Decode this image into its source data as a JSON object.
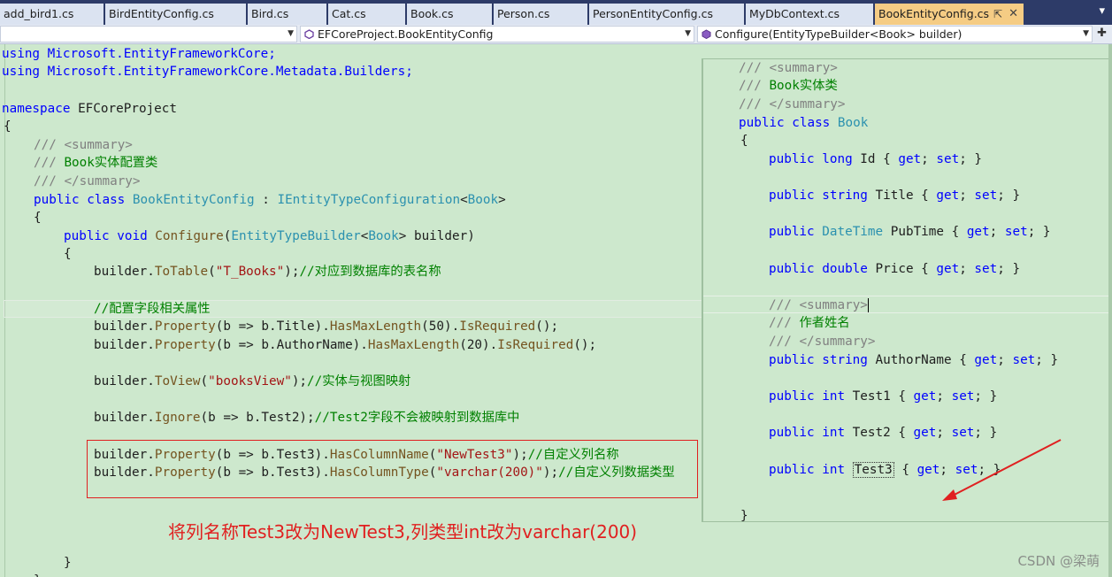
{
  "tabs": [
    {
      "label": "add_bird1.cs",
      "active": false
    },
    {
      "label": "BirdEntityConfig.cs",
      "active": false
    },
    {
      "label": "Bird.cs",
      "active": false
    },
    {
      "label": "Cat.cs",
      "active": false
    },
    {
      "label": "Book.cs",
      "active": false
    },
    {
      "label": "Person.cs",
      "active": false
    },
    {
      "label": "PersonEntityConfig.cs",
      "active": false
    },
    {
      "label": "MyDbContext.cs",
      "active": false
    },
    {
      "label": "BookEntityConfig.cs",
      "active": true
    }
  ],
  "tab_pin_icon": "pin-icon",
  "tab_close_icon": "close-icon",
  "tab_overflow_icon": "chevron-down-icon",
  "nav": {
    "project_value": "",
    "class_value": "EFCoreProject.BookEntityConfig",
    "member_value": "Configure(EntityTypeBuilder<Book> builder)"
  },
  "code": {
    "using1": "using Microsoft.EntityFrameworkCore;",
    "using2": "using Microsoft.EntityFrameworkCore.Metadata.Builders;",
    "namespace_name": "EFCoreProject",
    "doc_open": "<summary>",
    "doc_text": "Book实体配置类",
    "doc_close": "</summary>",
    "class_name": "BookEntityConfig",
    "interface_name": "IEntityTypeConfiguration",
    "type_arg": "Book",
    "method_name": "Configure",
    "param_type": "EntityTypeBuilder",
    "param_name": "builder",
    "to_table_arg": "\"T_Books\"",
    "to_table_comment": "//对应到数据库的表名称",
    "config_comment": "//配置字段相关属性",
    "title_len": "50",
    "author_len": "20",
    "view_arg": "\"booksView\"",
    "view_comment": "//实体与视图映射",
    "ignore_comment": "//Test2字段不会被映射到数据库中",
    "col_name_arg": "\"NewTest3\"",
    "col_name_comment": "//自定义列名称",
    "col_type_arg": "\"varchar(200)\"",
    "col_type_comment": "//自定义列数据类型"
  },
  "peek": {
    "doc_text": "Book实体类",
    "class_name": "Book",
    "author_doc": "作者姓名"
  },
  "annotation": "将列名称Test3改为NewTest3,列类型int改为varchar(200)",
  "watermark": "CSDN @梁萌",
  "colors": {
    "background": "#cde8cd",
    "keyword": "#0000ff",
    "type": "#2b91af",
    "comment": "#008000",
    "string": "#a31515",
    "annotation": "#e02020",
    "active_tab": "#f5cc84"
  }
}
